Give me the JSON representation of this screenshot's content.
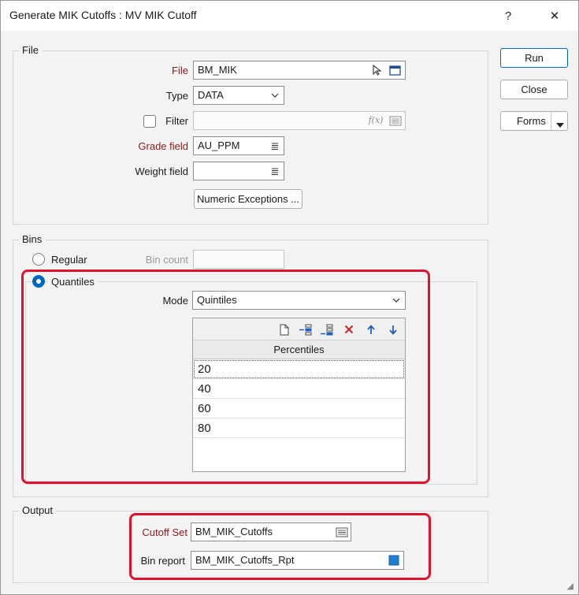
{
  "window": {
    "title": "Generate MIK Cutoffs : MV MIK Cutoff",
    "help_label": "?",
    "close_label": "✕"
  },
  "file_group": {
    "legend": "File",
    "file_label": "File",
    "file_value": "BM_MIK",
    "type_label": "Type",
    "type_value": "DATA",
    "filter_label": "Filter",
    "filter_value": "",
    "filter_fx": "f(x)",
    "grade_label": "Grade field",
    "grade_value": "AU_PPM",
    "weight_label": "Weight field",
    "weight_value": "",
    "numeric_exceptions_label": "Numeric Exceptions ..."
  },
  "bins_group": {
    "legend": "Bins",
    "regular_label": "Regular",
    "bin_count_label": "Bin count",
    "bin_count_value": "",
    "quantiles_label": "Quantiles",
    "mode_label": "Mode",
    "mode_value": "Quintiles",
    "grid_header": "Percentiles",
    "percentiles": [
      "20",
      "40",
      "60",
      "80"
    ]
  },
  "output_group": {
    "legend": "Output",
    "cutoff_label": "Cutoff Set",
    "cutoff_value": "BM_MIK_Cutoffs",
    "report_label": "Bin report",
    "report_value": "BM_MIK_Cutoffs_Rpt"
  },
  "actions": {
    "run_label": "Run",
    "close_label": "Close",
    "forms_label": "Forms"
  },
  "colors": {
    "accent": "#0067c0",
    "required_label": "#8b1a1a",
    "highlight": "#e0132f"
  }
}
